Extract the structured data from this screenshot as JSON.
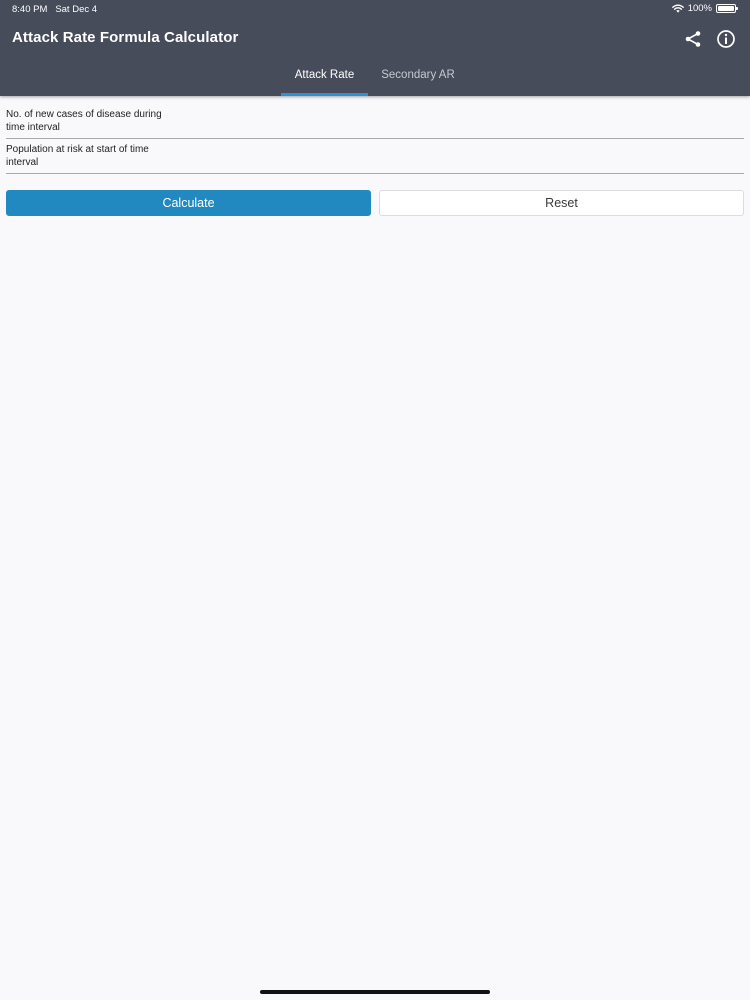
{
  "status_bar": {
    "time": "8:40 PM",
    "date": "Sat Dec 4",
    "battery": "100%",
    "battery_level": 1.0,
    "wifi_icon": "wifi-icon",
    "battery_icon": "battery-icon"
  },
  "header": {
    "title": "Attack Rate Formula Calculator",
    "share_icon": "share-icon",
    "info_icon": "info-icon",
    "background": "#474c5a"
  },
  "tabs": [
    {
      "label": "Attack Rate",
      "active": true
    },
    {
      "label": "Secondary AR",
      "active": false
    }
  ],
  "form": {
    "fields": [
      {
        "label": "No. of new cases of disease during time interval",
        "value": "",
        "placeholder": ""
      },
      {
        "label": "Population at risk at start of time interval",
        "value": "",
        "placeholder": ""
      }
    ],
    "calculate_label": "Calculate",
    "reset_label": "Reset"
  },
  "colors": {
    "accent": "#2289c0",
    "tab_indicator": "#2f8fd6",
    "background": "#f9f9fb"
  }
}
